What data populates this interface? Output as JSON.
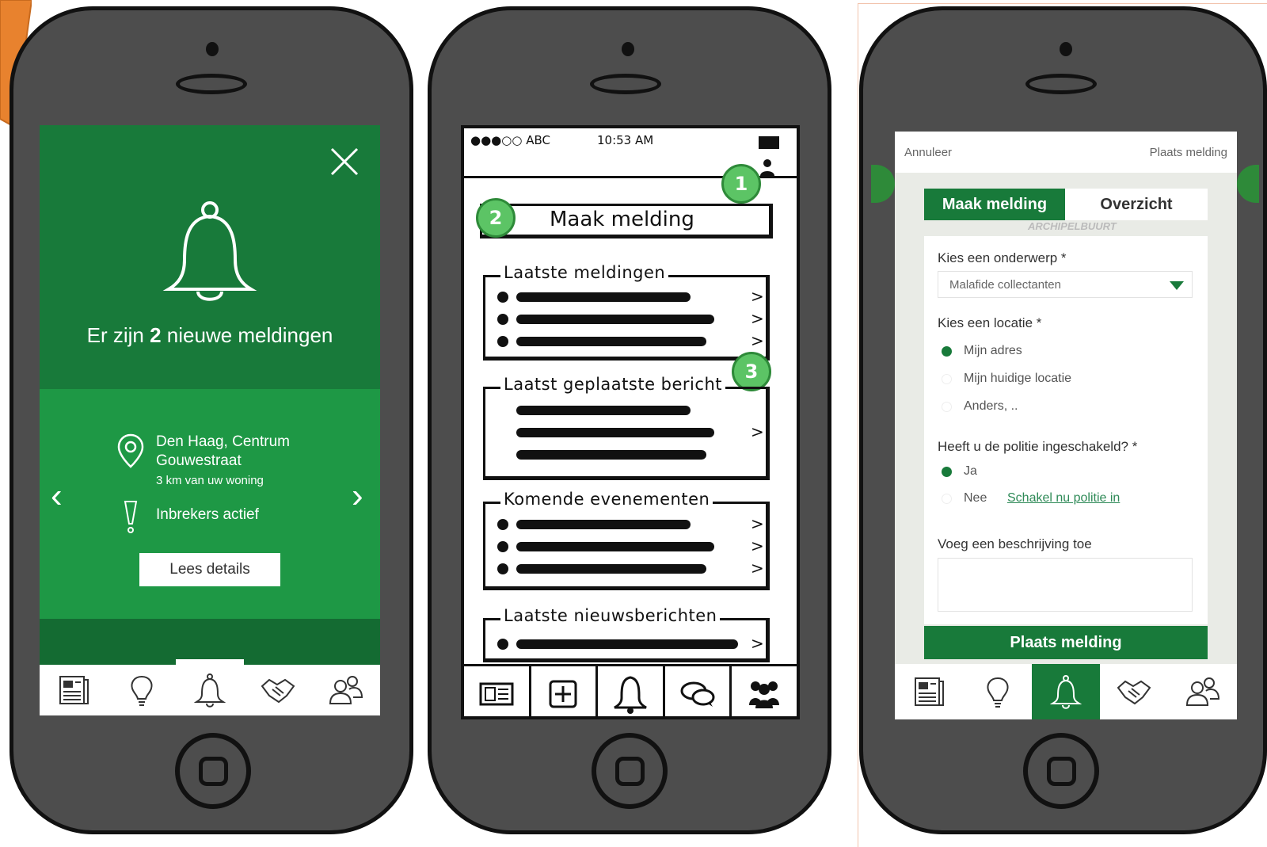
{
  "screen1": {
    "title_prefix": "Er zijn ",
    "title_count": "2",
    "title_suffix": " nieuwe meldingen",
    "location_line1": "Den Haag, Centrum",
    "location_line2": "Gouwestraat",
    "location_distance": "3 km van uw woning",
    "alert_text": "Inbrekers actief",
    "details_button": "Lees details",
    "prev_arrow": "‹",
    "next_arrow": "›",
    "close_glyph": "✕"
  },
  "screen2": {
    "status_carrier": "●●●○○ ABC",
    "status_time": "10:53 AM",
    "create_button": "Maak melding",
    "sections": [
      {
        "title": "Laatste meldingen"
      },
      {
        "title": "Laatst geplaatste bericht"
      },
      {
        "title": "Komende evenementen"
      },
      {
        "title": "Laatste nieuwsberichten"
      }
    ],
    "badges": [
      "1",
      "2",
      "3"
    ],
    "chevron": ">"
  },
  "screen3": {
    "cancel": "Annuleer",
    "submit_top": "Plaats melding",
    "tabs": {
      "active": "Maak melding",
      "inactive": "Overzicht"
    },
    "map_label": "ARCHIPELBUURT",
    "subject_label": "Kies een onderwerp *",
    "subject_value": "Malafide collectanten",
    "location_label": "Kies een locatie *",
    "location_options": [
      "Mijn adres",
      "Mijn huidige locatie",
      "Anders, .."
    ],
    "police_label": "Heeft u de politie ingeschakeld? *",
    "police_yes": "Ja",
    "police_no": "Nee",
    "police_link": "Schakel nu politie in",
    "description_label": "Voeg een beschrijving toe",
    "submit_button": "Plaats melding"
  },
  "colors": {
    "brand_green": "#187a3a",
    "light_green": "#1e9845",
    "badge_green": "#5cc465",
    "orange": "#e8822e"
  },
  "tab_icons": [
    "newspaper-icon",
    "lightbulb-icon",
    "bell-icon",
    "handshake-icon",
    "people-icon"
  ]
}
